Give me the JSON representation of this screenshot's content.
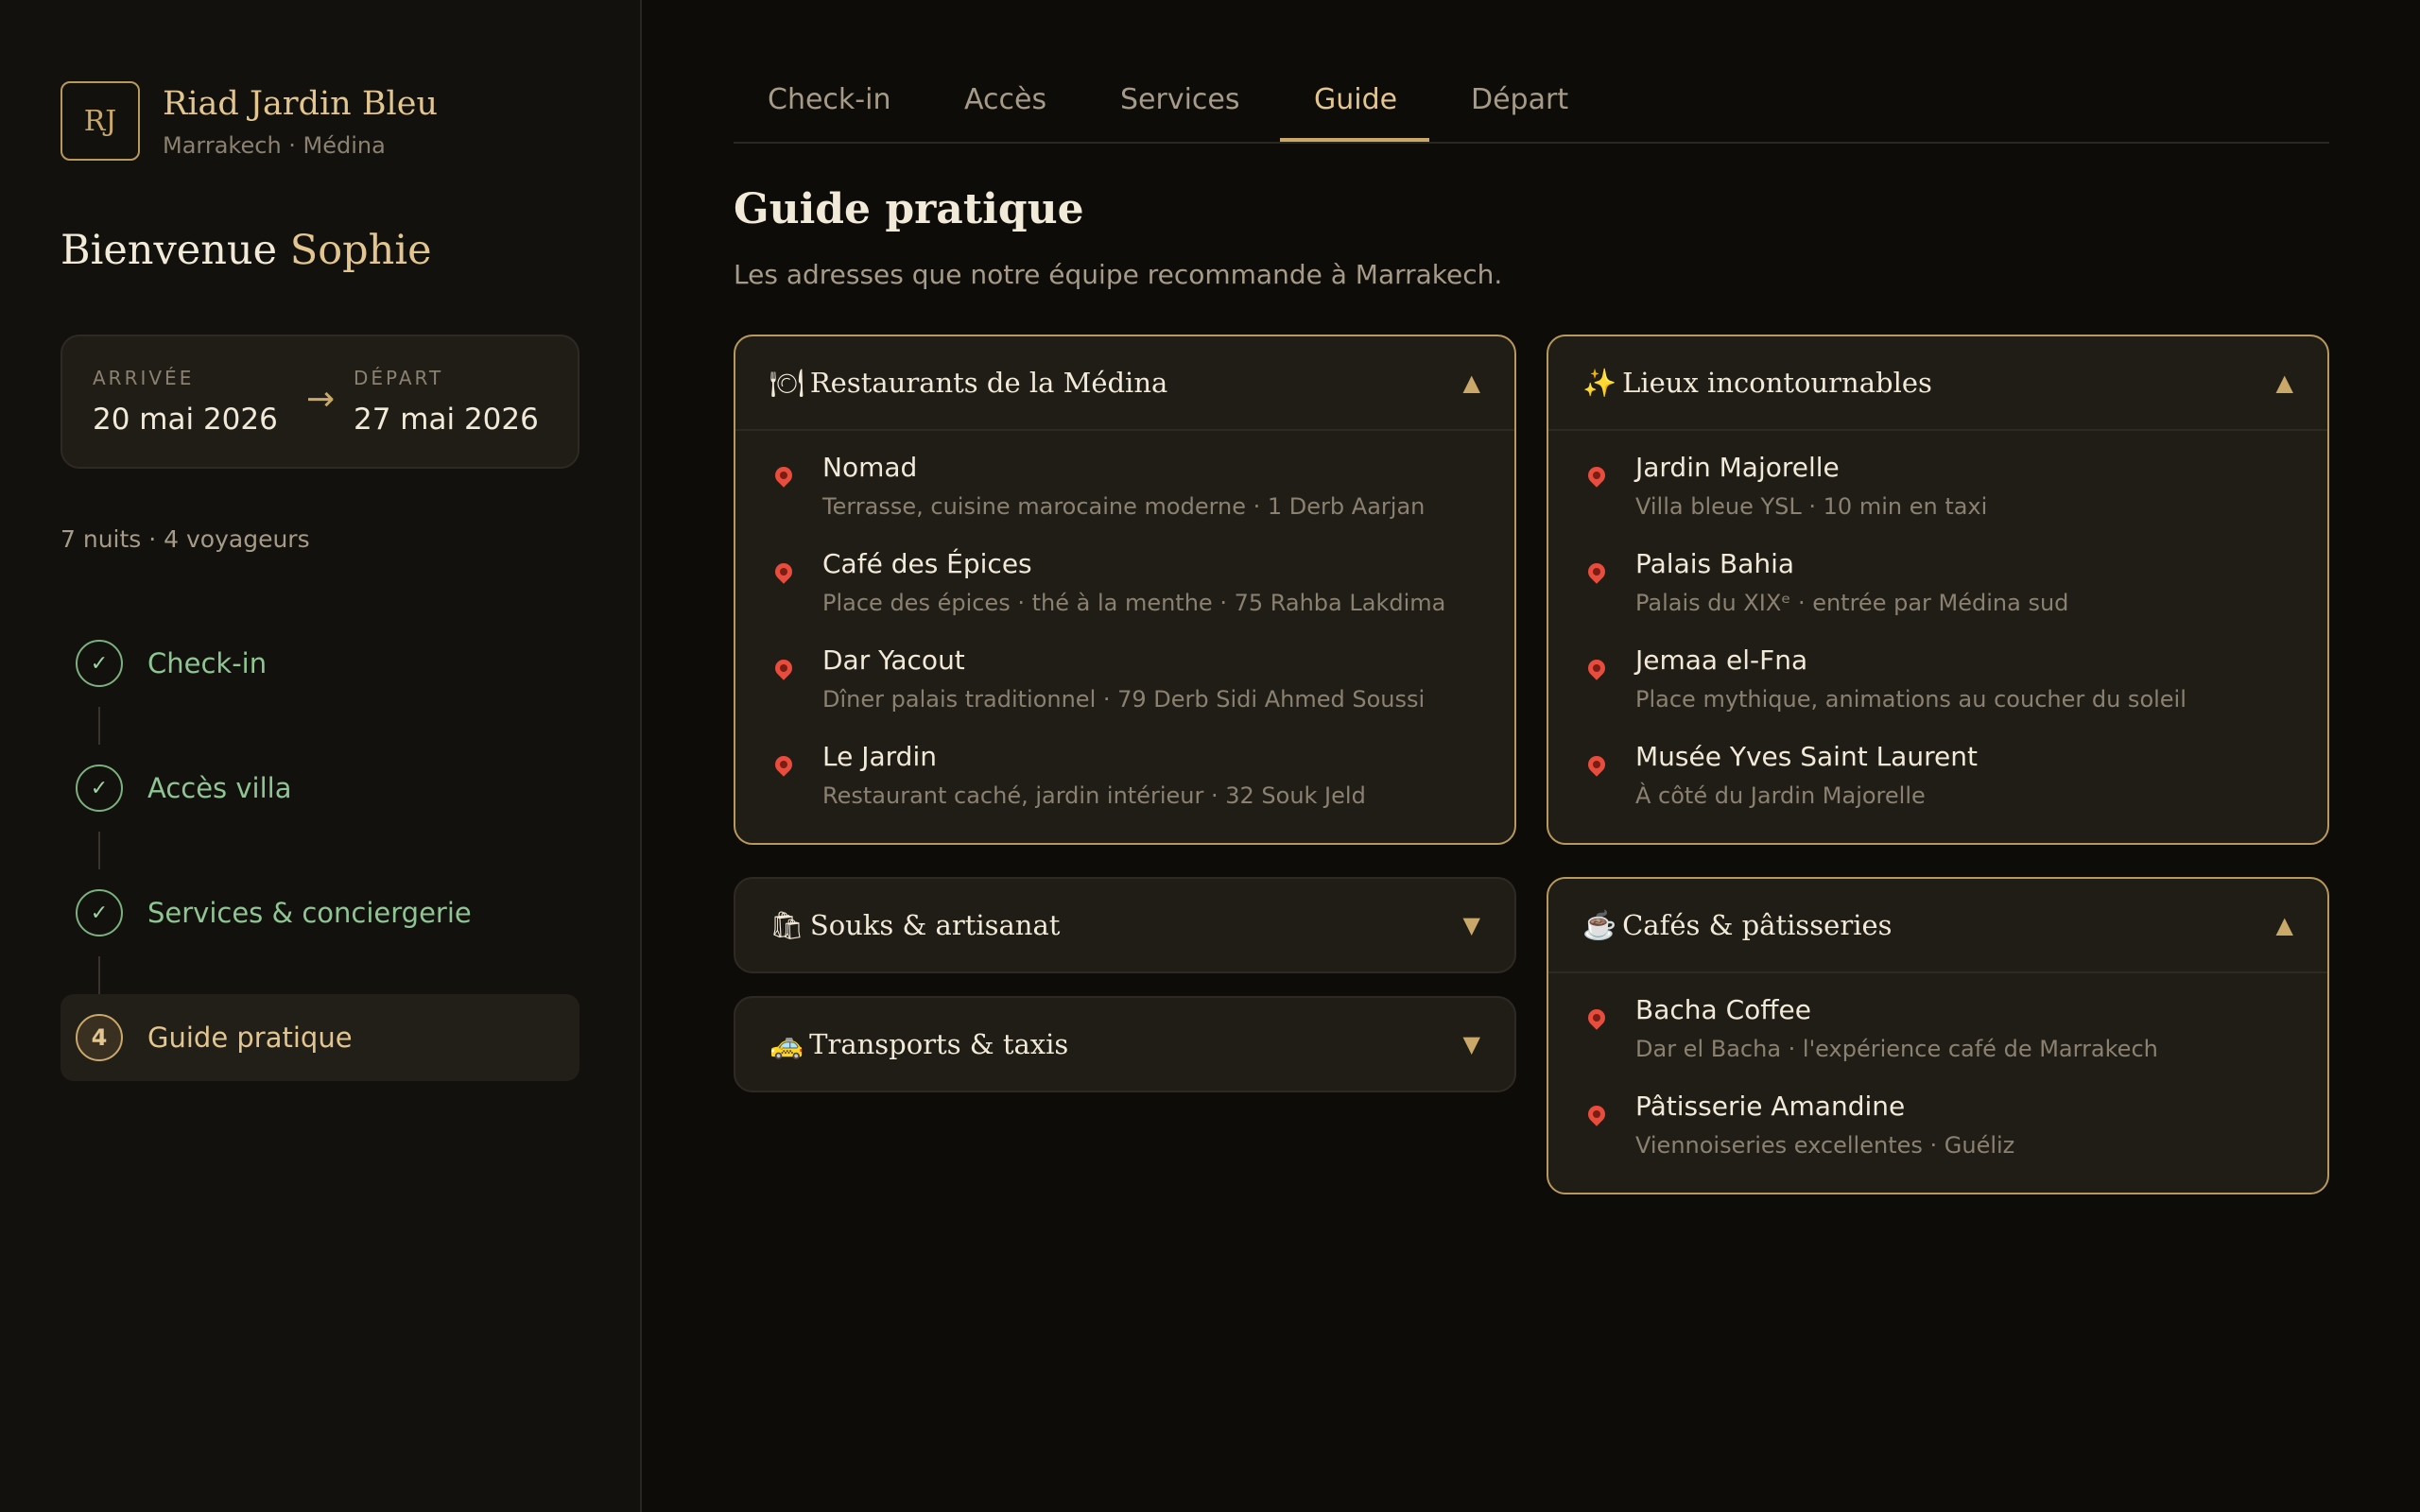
{
  "brand": {
    "initials": "RJ",
    "name": "Riad Jardin Bleu",
    "location": "Marrakech · Médina"
  },
  "welcome": {
    "greeting": "Bienvenue",
    "name": "Sophie"
  },
  "stay": {
    "arrival_label": "ARRIVÉE",
    "arrival_date": "20 mai 2026",
    "departure_label": "DÉPART",
    "departure_date": "27 mai 2026",
    "summary": "7 nuits · 4 voyageurs"
  },
  "steps": [
    {
      "label": "Check-in",
      "marker": "✓",
      "status": "done"
    },
    {
      "label": "Accès villa",
      "marker": "✓",
      "status": "done"
    },
    {
      "label": "Services & conciergerie",
      "marker": "✓",
      "status": "done"
    },
    {
      "label": "Guide pratique",
      "marker": "4",
      "status": "active"
    }
  ],
  "tabs": [
    "Check-in",
    "Accès",
    "Services",
    "Guide",
    "Départ"
  ],
  "active_tab": "Guide",
  "page": {
    "title": "Guide pratique",
    "subtitle": "Les adresses que notre équipe recommande à Marrakech."
  },
  "sections": {
    "restaurants": {
      "emoji": "🍽",
      "title": "Restaurants de la Médina",
      "expanded": true,
      "caret": "▲",
      "places": [
        {
          "name": "Nomad",
          "desc": "Terrasse, cuisine marocaine moderne · 1 Derb Aarjan"
        },
        {
          "name": "Café des Épices",
          "desc": "Place des épices · thé à la menthe · 75 Rahba Lakdima"
        },
        {
          "name": "Dar Yacout",
          "desc": "Dîner palais traditionnel · 79 Derb Sidi Ahmed Soussi"
        },
        {
          "name": "Le Jardin",
          "desc": "Restaurant caché, jardin intérieur · 32 Souk Jeld"
        }
      ]
    },
    "souks": {
      "emoji": "🛍",
      "title": "Souks & artisanat",
      "expanded": false,
      "caret": "▼"
    },
    "transports": {
      "emoji": "🚕",
      "title": "Transports & taxis",
      "expanded": false,
      "caret": "▼"
    },
    "lieux": {
      "emoji": "✨",
      "title": "Lieux incontournables",
      "expanded": true,
      "caret": "▲",
      "places": [
        {
          "name": "Jardin Majorelle",
          "desc": "Villa bleue YSL · 10 min en taxi"
        },
        {
          "name": "Palais Bahia",
          "desc": "Palais du XIXᵉ · entrée par Médina sud"
        },
        {
          "name": "Jemaa el-Fna",
          "desc": "Place mythique, animations au coucher du soleil"
        },
        {
          "name": "Musée Yves Saint Laurent",
          "desc": "À côté du Jardin Majorelle"
        }
      ]
    },
    "cafes": {
      "emoji": "☕",
      "title": "Cafés & pâtisseries",
      "expanded": true,
      "caret": "▲",
      "places": [
        {
          "name": "Bacha Coffee",
          "desc": "Dar el Bacha · l'expérience café de Marrakech"
        },
        {
          "name": "Pâtisserie Amandine",
          "desc": "Viennoiseries excellentes · Guéliz"
        }
      ]
    }
  },
  "colors": {
    "accent": "#c9a86a",
    "done": "#8fc493",
    "pin": "#e74c3c",
    "background": "#0e0c09"
  }
}
